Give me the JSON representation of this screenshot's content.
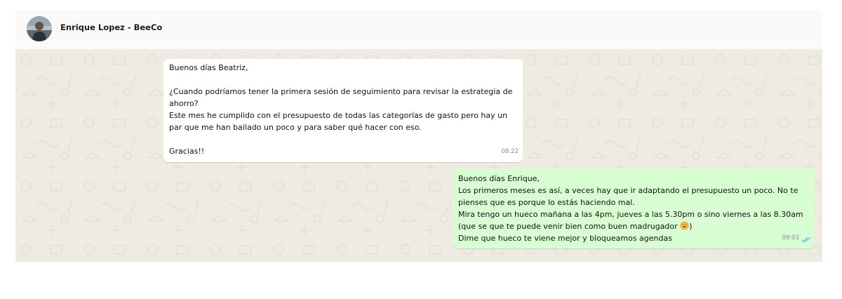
{
  "header": {
    "contact_name": "Enrique Lopez - BeeCo",
    "avatar_icon": "person-photo-avatar"
  },
  "colors": {
    "chat_background": "#efeae2",
    "incoming_bubble": "#ffffff",
    "outgoing_bubble": "#d9fdd3",
    "read_ticks": "#53bdeb"
  },
  "messages": [
    {
      "direction": "incoming",
      "lines": [
        "Buenos días Beatriz,",
        "",
        "¿Cuando podríamos tener la primera sesión de seguimiento para revisar la estrategia de",
        "ahorro?",
        "Este mes he cumplido con el presupuesto de todas las categorías de gasto pero hay un",
        "par que me han bailado un poco y para saber qué hacer con eso.",
        "",
        "Gracias!!"
      ],
      "time": "08:22"
    },
    {
      "direction": "outgoing",
      "lines": [
        "Buenos días Enrique,",
        "Los primeros meses es así, a veces hay que ir adaptando el presupuesto un poco. No te",
        "pienses que es porque lo estás haciendo mal.",
        "Mira tengo un hueco mañana a las 4pm, jueves a las 5.30pm o sino viernes a las 8.30am",
        "(que se que te puede venir bien como buen madrugador ",
        ")",
        "Dime que hueco te viene mejor y bloqueamos agendas"
      ],
      "emoji_icon": "grinning-sweat-emoji-icon",
      "time": "09:03",
      "status_icon": "double-check-read-icon"
    }
  ]
}
